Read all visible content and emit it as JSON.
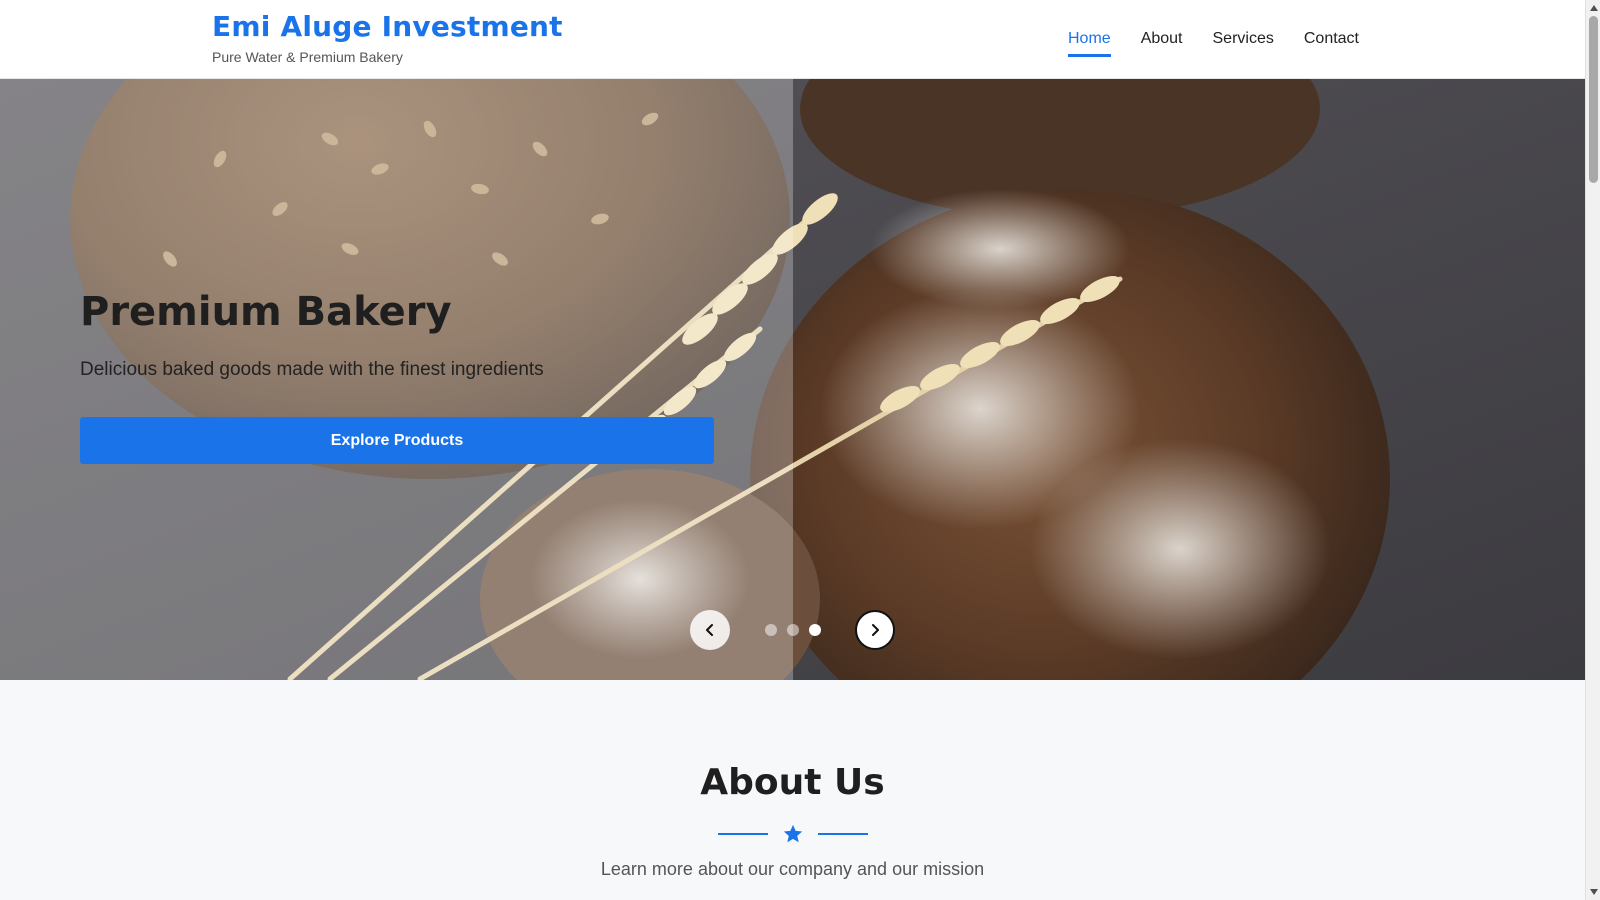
{
  "header": {
    "brand_title": "Emi Aluge Investment",
    "brand_subtitle": "Pure Water & Premium Bakery",
    "nav": [
      {
        "label": "Home",
        "active": true
      },
      {
        "label": "About",
        "active": false
      },
      {
        "label": "Services",
        "active": false
      },
      {
        "label": "Contact",
        "active": false
      }
    ]
  },
  "hero": {
    "title": "Premium Bakery",
    "subtitle": "Delicious baked goods made with the finest ingredients",
    "cta_label": "Explore Products",
    "slides_total": 3,
    "active_slide": 3,
    "prev_icon": "chevron-left-icon",
    "next_icon": "chevron-right-icon"
  },
  "about": {
    "title": "About Us",
    "divider_icon": "star-icon",
    "subtitle": "Learn more about our company and our mission"
  },
  "colors": {
    "accent": "#1a73e8",
    "header_bg": "#ffffff",
    "page_bg": "#f7f8fa"
  }
}
